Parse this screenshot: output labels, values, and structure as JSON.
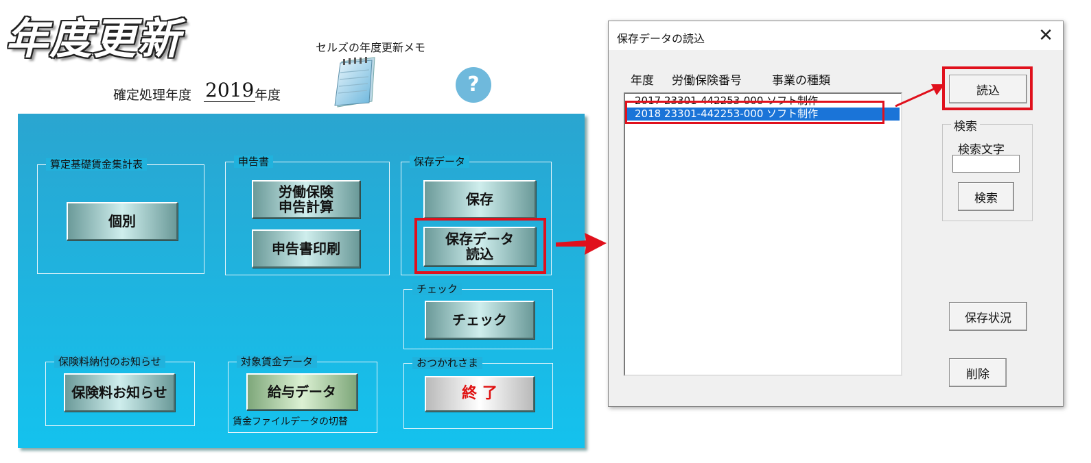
{
  "app": {
    "title": "年度更新",
    "memo_label": "セルズの年度更新メモ",
    "year_label": "確定処理年度",
    "year_value": "2019",
    "year_unit": "年度",
    "help_symbol": "?"
  },
  "groups": {
    "wage_summary": {
      "label": "算定基礎賃金集計表",
      "button": "個別"
    },
    "declaration": {
      "label": "申告書",
      "calc_button": "労働保険\n申告計算",
      "print_button": "申告書印刷"
    },
    "saved_data": {
      "label": "保存データ",
      "save_button": "保存",
      "load_button": "保存データ\n読込"
    },
    "check": {
      "label": "チェック",
      "button": "チェック"
    },
    "notice": {
      "label": "保険料納付のお知らせ",
      "button": "保険料お知らせ"
    },
    "wage_data": {
      "label": "対象賃金データ",
      "button": "給与データ",
      "note": "賃金ファイルデータの切替"
    },
    "finish": {
      "label": "おつかれさま",
      "button": "終 了"
    }
  },
  "dialog": {
    "title": "保存データの読込",
    "close_symbol": "✕",
    "columns": [
      "年度",
      "労働保険番号",
      "事業の種類"
    ],
    "rows": [
      {
        "text": "2017 23301-442253-000 ソフト制作",
        "selected": false
      },
      {
        "text": "2018 23301-442253-000 ソフト制作",
        "selected": true
      }
    ],
    "load_button": "読込",
    "search_group_label": "検索",
    "search_text_label": "検索文字",
    "search_value": "",
    "search_button": "検索",
    "status_button": "保存状況",
    "delete_button": "削除"
  },
  "colors": {
    "panel_top": "#2aa5d0",
    "panel_bottom": "#14c2ee",
    "highlight": "#e0101c",
    "selection": "#1a74d8"
  },
  "icons": [
    "notepad-icon",
    "help-icon",
    "close-icon",
    "red-arrow-icon"
  ]
}
